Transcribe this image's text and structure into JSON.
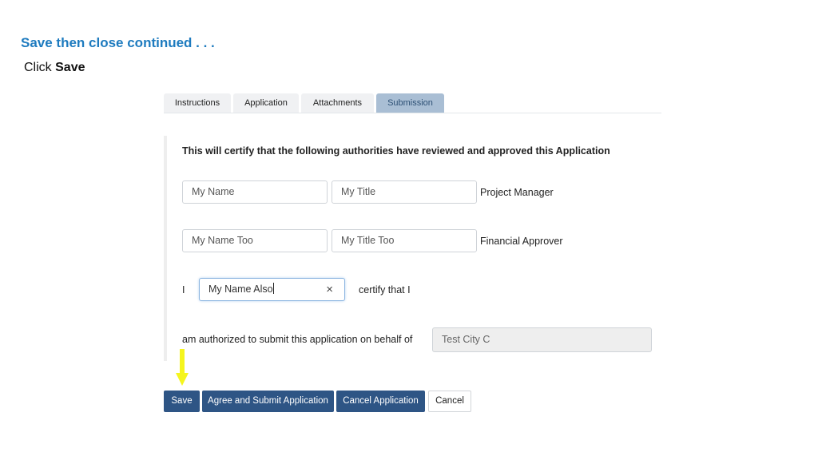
{
  "slide": {
    "title": "Save then close continued . . .",
    "instruction_prefix": "Click",
    "instruction_target": "Save"
  },
  "tabs": [
    {
      "label": "Instructions",
      "active": false
    },
    {
      "label": "Application",
      "active": false
    },
    {
      "label": "Attachments",
      "active": false
    },
    {
      "label": "Submission",
      "active": true
    }
  ],
  "form": {
    "heading": "This will certify that the following authorities have reviewed and approved this Application",
    "rows": [
      {
        "name": "My Name",
        "title": "My Title",
        "role": "Project Manager"
      },
      {
        "name": "My Name Too",
        "title": "My Title Too",
        "role": "Financial Approver"
      }
    ],
    "certify_prefix": "I",
    "certify_name": "My Name Also",
    "certify_suffix": "certify that I",
    "behalf_label": "am authorized to submit this application on behalf of",
    "behalf_value": "Test City C",
    "clear_icon": "×"
  },
  "buttons": {
    "save": "Save",
    "agree_submit": "Agree and Submit Application",
    "cancel_application": "Cancel Application",
    "cancel": "Cancel"
  },
  "annotation": {
    "arrow_color": "#f5f51e"
  }
}
